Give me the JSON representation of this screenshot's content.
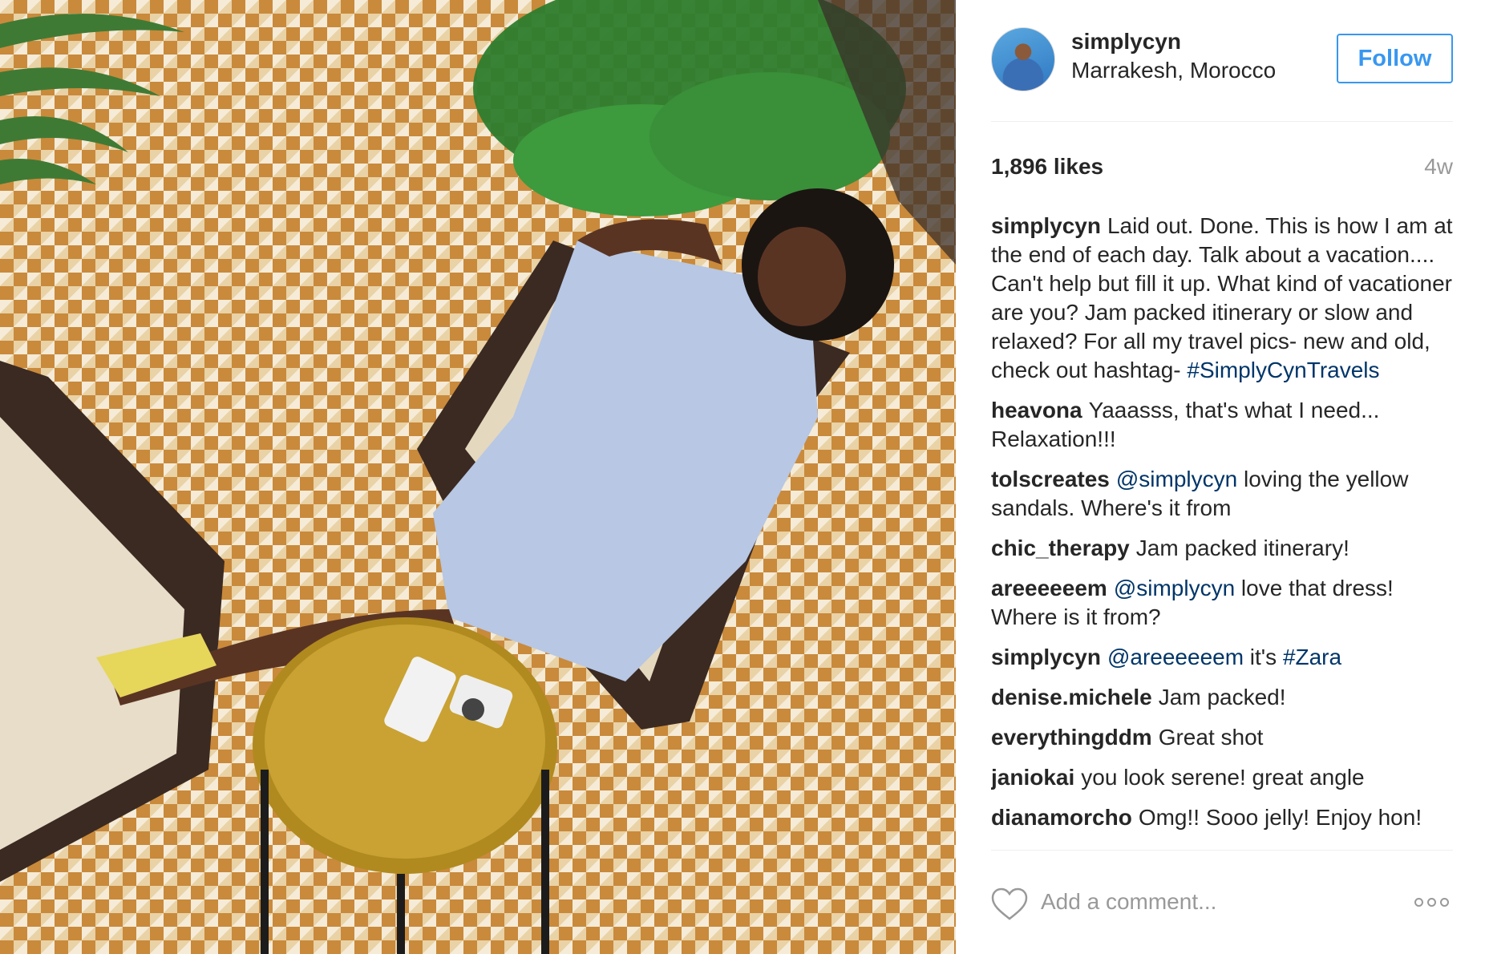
{
  "post": {
    "username": "simplycyn",
    "location": "Marrakesh, Morocco",
    "follow_label": "Follow",
    "likes": "1,896 likes",
    "time_ago": "4w"
  },
  "comments": [
    {
      "user": "simplycyn",
      "parts": [
        {
          "text": "Laid out. Done. This is how I am at the end of each day. Talk about a vacation.... Can't help but fill it up. What kind of vacationer are you? Jam packed itinerary or slow and relaxed? For all my travel pics- new and old, check out hashtag- "
        },
        {
          "text": "#SimplyCynTravels",
          "link": true
        }
      ]
    },
    {
      "user": "heavona",
      "parts": [
        {
          "text": "Yaaasss, that's what I need... Relaxation!!!"
        }
      ]
    },
    {
      "user": "tolscreates",
      "parts": [
        {
          "text": "@simplycyn",
          "link": true
        },
        {
          "text": " loving the yellow sandals. Where's it from"
        }
      ]
    },
    {
      "user": "chic_therapy",
      "parts": [
        {
          "text": "Jam packed itinerary!"
        }
      ]
    },
    {
      "user": "areeeeeem",
      "parts": [
        {
          "text": "@simplycyn",
          "link": true
        },
        {
          "text": " love that dress! Where is it from?"
        }
      ]
    },
    {
      "user": "simplycyn",
      "parts": [
        {
          "text": "@areeeeeem",
          "link": true
        },
        {
          "text": " it's "
        },
        {
          "text": "#Zara",
          "link": true
        }
      ]
    },
    {
      "user": "denise.michele",
      "parts": [
        {
          "text": "Jam packed!"
        }
      ]
    },
    {
      "user": "everythingddm",
      "parts": [
        {
          "text": "Great shot"
        }
      ]
    },
    {
      "user": "janiokai",
      "parts": [
        {
          "text": "you look serene! great angle"
        }
      ]
    },
    {
      "user": "dianamorcho",
      "parts": [
        {
          "text": "Omg!! Sooo jelly! Enjoy hon!"
        }
      ]
    }
  ],
  "comment_bar": {
    "placeholder": "Add a comment...",
    "like_icon": "heart-icon",
    "more_icon": "more-options-icon"
  }
}
